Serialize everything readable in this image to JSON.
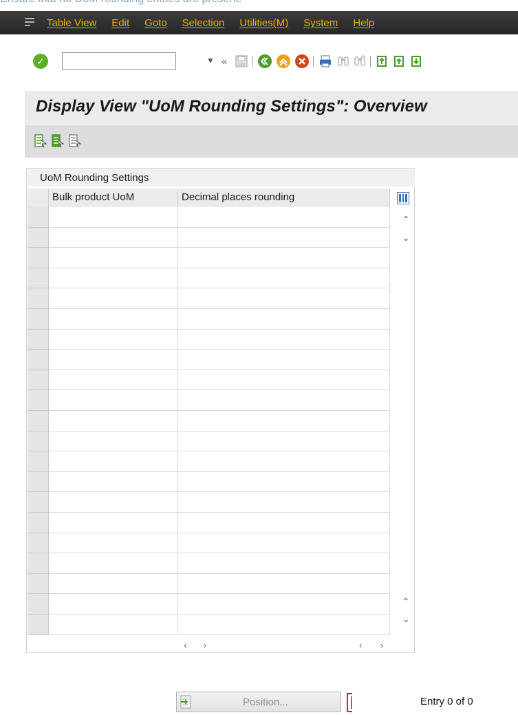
{
  "instruction": "Ensure that no UoM rounding entries are present.",
  "menu": {
    "items": [
      {
        "label": "Table View"
      },
      {
        "label": "Edit"
      },
      {
        "label": "Goto"
      },
      {
        "label": "Selection"
      },
      {
        "label": "Utilities(M)"
      },
      {
        "label": "System"
      },
      {
        "label": "Help"
      }
    ]
  },
  "toolbar": {
    "command_field_value": "",
    "icons": [
      "check-icon",
      "dropdown-icon",
      "back-double-icon",
      "save-icon",
      "back-icon",
      "exit-icon",
      "cancel-icon",
      "print-icon",
      "find-icon",
      "find-next-icon",
      "first-page-icon",
      "previous-page-icon",
      "next-page-icon"
    ]
  },
  "title": "Display View \"UoM Rounding Settings\": Overview",
  "table": {
    "title": "UoM Rounding Settings",
    "columns": [
      "Bulk product UoM",
      "Decimal places rounding"
    ],
    "rows": []
  },
  "footer": {
    "position_label": "Position...",
    "entry_text": "Entry 0 of 0"
  },
  "colors": {
    "menu_bg": "#2f2f2f",
    "menu_text": "#f0b200",
    "title_bg": "#ebebeb",
    "app_toolbar_bg": "#dddddd"
  }
}
